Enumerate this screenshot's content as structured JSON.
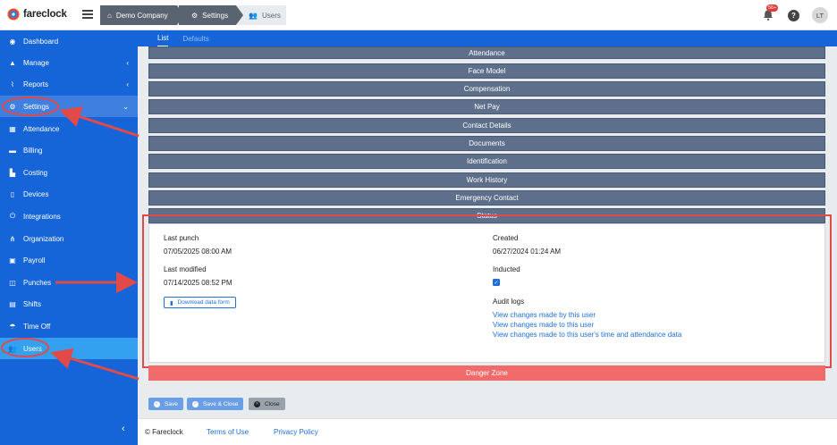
{
  "app": {
    "name": "fareclock"
  },
  "breadcrumb": {
    "company": "Demo Company",
    "settings": "Settings",
    "users": "Users"
  },
  "topbar": {
    "notifications": "56+",
    "help": "?",
    "user_initials": "LT"
  },
  "sidebar": {
    "items": [
      {
        "label": "Dashboard"
      },
      {
        "label": "Manage"
      },
      {
        "label": "Reports"
      },
      {
        "label": "Settings"
      },
      {
        "label": "Attendance"
      },
      {
        "label": "Billing"
      },
      {
        "label": "Costing"
      },
      {
        "label": "Devices"
      },
      {
        "label": "Integrations"
      },
      {
        "label": "Organization"
      },
      {
        "label": "Payroll"
      },
      {
        "label": "Punches"
      },
      {
        "label": "Shifts"
      },
      {
        "label": "Time Off"
      },
      {
        "label": "Users"
      }
    ]
  },
  "subtabs": {
    "list": "List",
    "defaults": "Defaults"
  },
  "sections": [
    "Attendance",
    "Face Model",
    "Compensation",
    "Net Pay",
    "Contact Details",
    "Documents",
    "Identification",
    "Work History",
    "Emergency Contact",
    "Status"
  ],
  "status": {
    "last_punch_label": "Last punch",
    "last_punch_value": "07/05/2025 08:00 AM",
    "last_modified_label": "Last modified",
    "last_modified_value": "07/14/2025 08:52 PM",
    "download_label": "Download data form",
    "created_label": "Created",
    "created_value": "06/27/2024 01:24 AM",
    "inducted_label": "Inducted",
    "audit_label": "Audit logs",
    "audit_links": [
      "View changes made by this user",
      "View changes made to this user",
      "View changes made to this user's time and attendance data"
    ]
  },
  "danger_zone": "Danger Zone",
  "buttons": {
    "save": "Save",
    "save_close": "Save & Close",
    "close": "Close"
  },
  "footer": {
    "copyright": "© Fareclock",
    "terms": "Terms of Use",
    "privacy": "Privacy Policy"
  },
  "colors": {
    "sidebar": "#1565d8",
    "section_bar": "#5d6f8a",
    "danger": "#f26b6b",
    "annotation": "#e24a4a",
    "link": "#1e6fd9"
  }
}
